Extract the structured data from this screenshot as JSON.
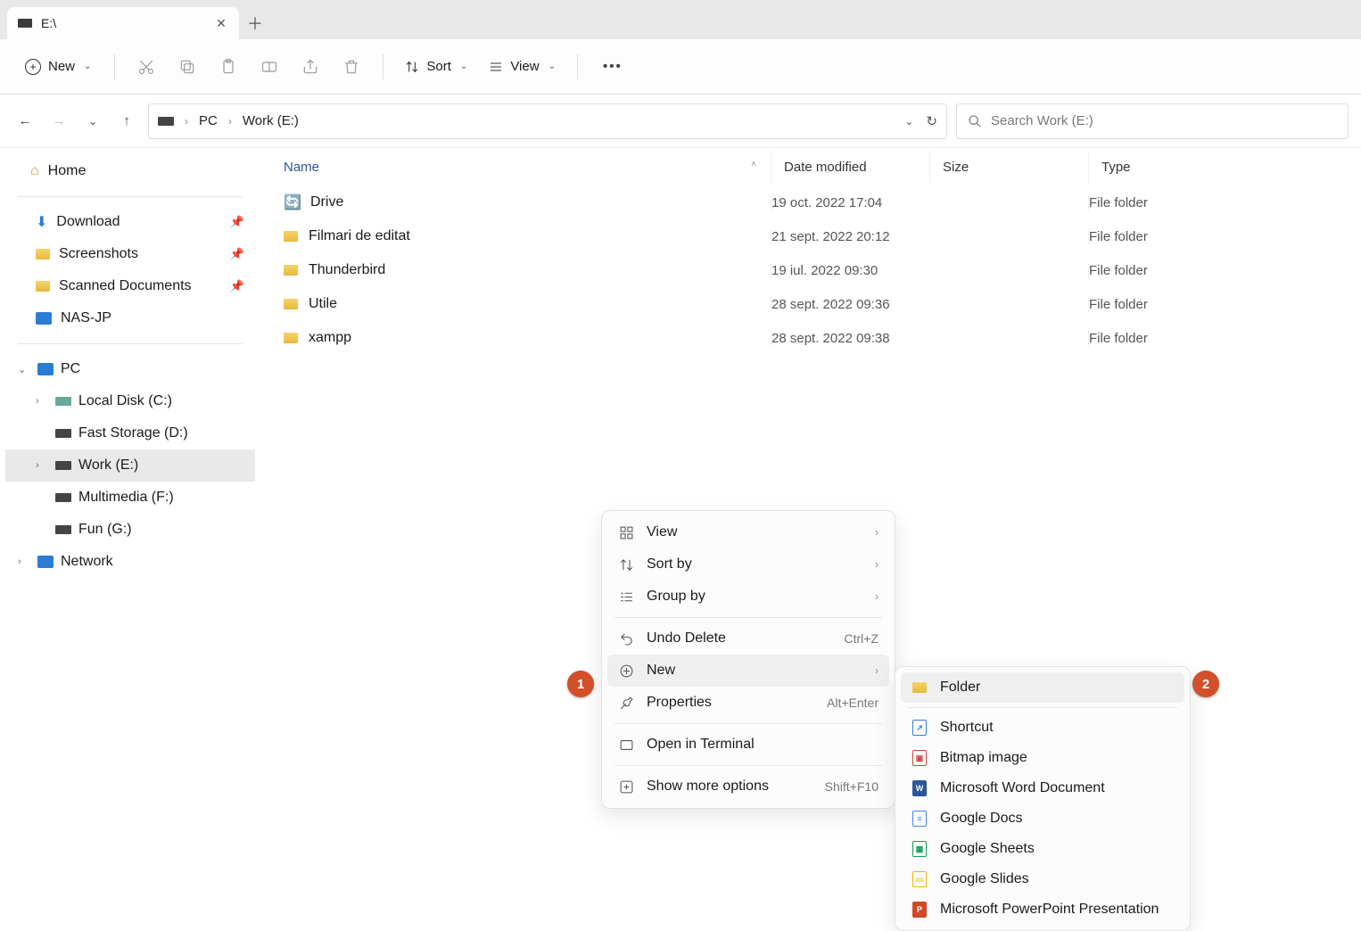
{
  "tab": {
    "title": "E:\\"
  },
  "toolbar": {
    "new_label": "New",
    "sort_label": "Sort",
    "view_label": "View"
  },
  "breadcrumbs": {
    "pc": "PC",
    "drive": "Work (E:)"
  },
  "search": {
    "placeholder": "Search Work (E:)"
  },
  "sidebar": {
    "home": "Home",
    "quick": [
      {
        "label": "Download"
      },
      {
        "label": "Screenshots"
      },
      {
        "label": "Scanned Documents"
      },
      {
        "label": "NAS-JP"
      }
    ],
    "pc": "PC",
    "drives": [
      {
        "label": "Local Disk (C:)"
      },
      {
        "label": "Fast Storage (D:)"
      },
      {
        "label": "Work (E:)",
        "selected": true
      },
      {
        "label": "Multimedia (F:)"
      },
      {
        "label": "Fun (G:)"
      }
    ],
    "network": "Network"
  },
  "columns": {
    "name": "Name",
    "date": "Date modified",
    "size": "Size",
    "type": "Type"
  },
  "rows": [
    {
      "name": "Drive",
      "date": "19 oct. 2022 17:04",
      "type": "File folder",
      "special": true
    },
    {
      "name": "Filmari de editat",
      "date": "21 sept. 2022 20:12",
      "type": "File folder"
    },
    {
      "name": "Thunderbird",
      "date": "19 iul. 2022 09:30",
      "type": "File folder"
    },
    {
      "name": "Utile",
      "date": "28 sept. 2022 09:36",
      "type": "File folder"
    },
    {
      "name": "xampp",
      "date": "28 sept. 2022 09:38",
      "type": "File folder"
    }
  ],
  "context_menu": {
    "view": "View",
    "sort_by": "Sort by",
    "group_by": "Group by",
    "undo_delete": "Undo Delete",
    "undo_shortcut": "Ctrl+Z",
    "new": "New",
    "properties": "Properties",
    "properties_shortcut": "Alt+Enter",
    "open_terminal": "Open in Terminal",
    "show_more": "Show more options",
    "show_more_shortcut": "Shift+F10"
  },
  "new_submenu": [
    "Folder",
    "Shortcut",
    "Bitmap image",
    "Microsoft Word Document",
    "Google Docs",
    "Google Sheets",
    "Google Slides",
    "Microsoft PowerPoint Presentation"
  ],
  "callouts": {
    "one": "1",
    "two": "2"
  }
}
